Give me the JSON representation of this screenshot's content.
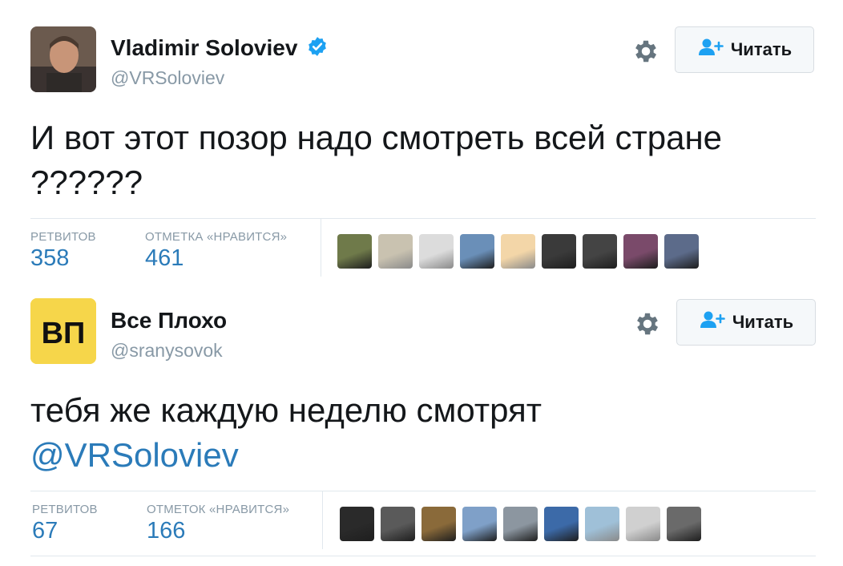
{
  "tweets": [
    {
      "author_name": "Vladimir Soloviev",
      "author_handle": "@VRSoloviev",
      "verified": true,
      "follow_label": "Читать",
      "text_lines": [
        "И вот этот позор надо смотреть всей стране",
        "??????"
      ],
      "mention": "",
      "retweets_label": "РЕТВИТОВ",
      "retweets": "358",
      "likes_label": "ОТМЕТКА «НРАВИТСЯ»",
      "likes": "461",
      "avatar_colors": [
        "#5a3e2a",
        "#c89a7a"
      ]
    },
    {
      "author_name": "Все Плохо",
      "author_handle": "@sranysovok",
      "verified": false,
      "avatar_text": "ВП",
      "follow_label": "Читать",
      "text_lines": [
        "тебя же каждую неделю смотрят"
      ],
      "mention": "@VRSoloviev",
      "retweets_label": "РЕТВИТОВ",
      "retweets": "67",
      "likes_label": "ОТМЕТОК «НРАВИТСЯ»",
      "likes": "166",
      "avatar_colors": [
        "#f6d64a",
        "#111111"
      ]
    }
  ],
  "colors": {
    "link": "#2b7bb9",
    "muted": "#8899a6",
    "verified": "#1da1f2",
    "border": "#e1e8ed"
  },
  "likers": [
    [
      "#6f7a4a",
      "#c9c2b0",
      "#dcdcdc",
      "#6a8fb8",
      "#f3d6a8",
      "#3a3a3a",
      "#444444",
      "#7a4a6a",
      "#5c6b8a"
    ],
    [
      "#2a2a2a",
      "#5a5a5a",
      "#8a6a3a",
      "#7fa0c8",
      "#8c96a0",
      "#3c6aa8",
      "#9fc0d8",
      "#d0d0d0",
      "#6a6a6a"
    ]
  ]
}
